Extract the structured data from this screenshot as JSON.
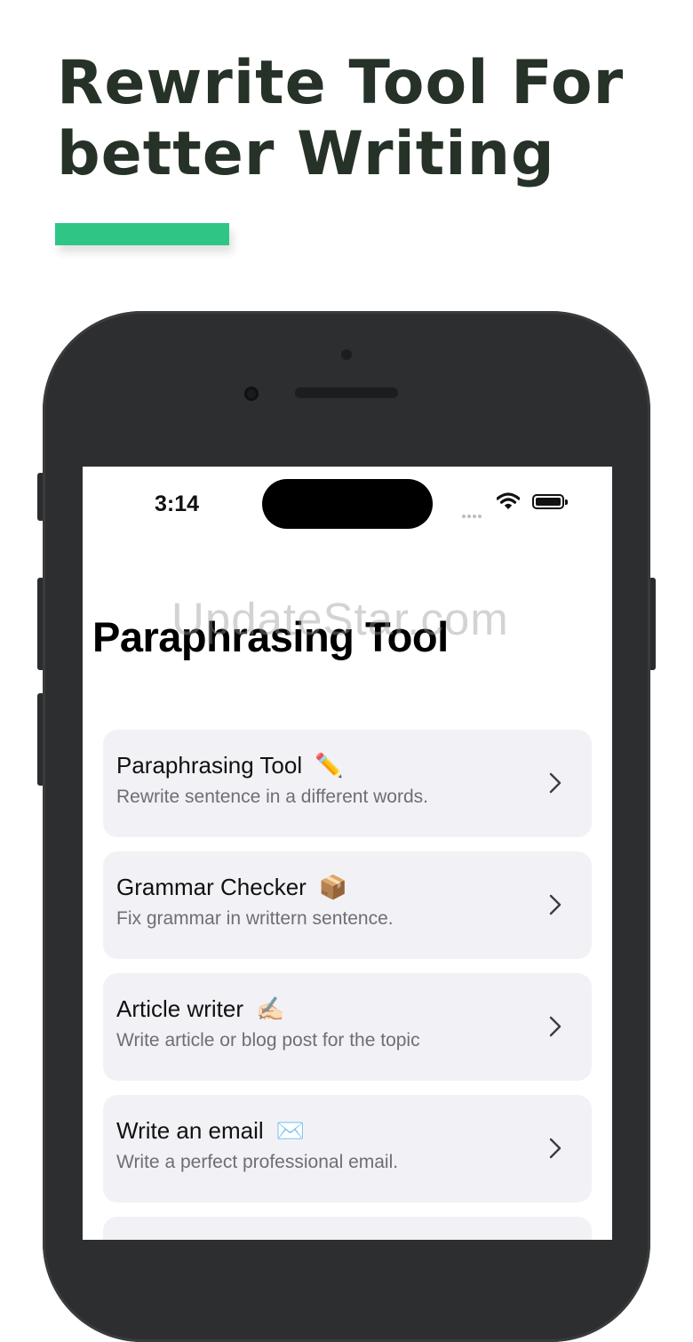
{
  "headline": {
    "line1": "Rewrite Tool For",
    "line2": "better Writing"
  },
  "status_bar": {
    "time": "3:14"
  },
  "watermark": "UpdateStar.com",
  "screen": {
    "title": "Paraphrasing Tool"
  },
  "tools": [
    {
      "title": "Paraphrasing Tool",
      "emoji": "✏️",
      "description": "Rewrite sentence in a different words."
    },
    {
      "title": "Grammar Checker",
      "emoji": "📦",
      "description": "Fix grammar in writtern sentence."
    },
    {
      "title": "Article writer",
      "emoji": "✍🏻",
      "description": "Write article or blog post for the topic"
    },
    {
      "title": "Write an email",
      "emoji": "✉️",
      "description": "Write a perfect professional email."
    }
  ],
  "colors": {
    "headline": "#263228",
    "accent": "#2fc585",
    "phone_frame": "#2d2e30",
    "card_background": "#f2f2f6",
    "description_text": "#6e6e73"
  },
  "icons": {
    "row_arrow": "chevron-right-icon",
    "wifi": "wifi-icon",
    "battery": "battery-icon",
    "signal": "signal-icon"
  }
}
